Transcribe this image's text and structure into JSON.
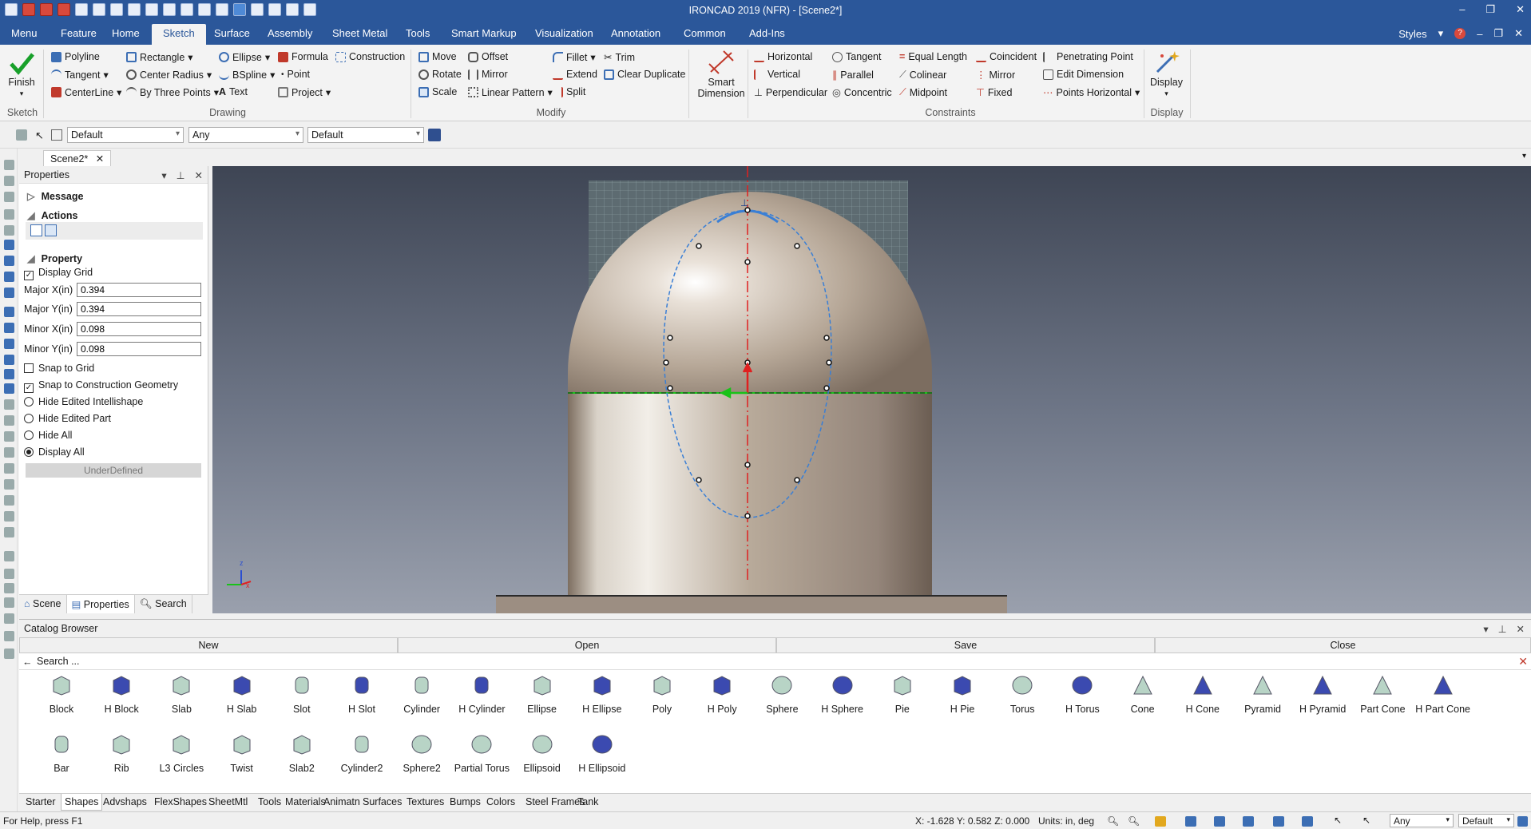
{
  "window": {
    "title": "IRONCAD 2019 (NFR) - [Scene2*]"
  },
  "menu": {
    "tabs": [
      "Menu",
      "Feature",
      "Home",
      "Surface",
      "Assembly",
      "Sheet Metal",
      "Tools",
      "Smart Markup",
      "Visualization",
      "Annotation",
      "Common",
      "Add-Ins"
    ],
    "active": "Sketch",
    "styles_label": "Styles"
  },
  "ribbon": {
    "sketch": {
      "finish": "Finish",
      "group": "Sketch"
    },
    "drawing": {
      "items": [
        "Polyline",
        "Rectangle",
        "Ellipse",
        "Formula",
        "Construction",
        "Tangent",
        "Center Radius",
        "BSpline",
        "Point",
        "CenterLine",
        "By Three Points",
        "Text",
        "Project"
      ],
      "group": "Drawing"
    },
    "modify": {
      "items": [
        "Move",
        "Offset",
        "Fillet",
        "Trim",
        "Rotate",
        "Mirror",
        "Extend",
        "Clear Duplicate",
        "Scale",
        "Linear Pattern",
        "Split"
      ],
      "group": "Modify"
    },
    "smart_dimension": "Smart Dimension",
    "constraints": {
      "items": [
        "Horizontal",
        "Tangent",
        "Equal Length",
        "Coincident",
        "Penetrating Point",
        "Vertical",
        "Parallel",
        "Colinear",
        "Mirror",
        "Edit Dimension",
        "Perpendicular",
        "Concentric",
        "Midpoint",
        "Fixed",
        "Points Horizontal"
      ],
      "group": "Constraints"
    },
    "display": {
      "label": "Display",
      "group": "Display"
    }
  },
  "toolbar": {
    "combo1": "Default",
    "combo2": "Any",
    "combo3": "Default"
  },
  "doc_tab": "Scene2*",
  "properties": {
    "title": "Properties",
    "message": "Message",
    "actions": "Actions",
    "property": "Property",
    "display_grid": "Display Grid",
    "fields": [
      {
        "label": "Major X(in)",
        "value": "0.394"
      },
      {
        "label": "Major Y(in)",
        "value": "0.394"
      },
      {
        "label": "Minor X(in)",
        "value": "0.098"
      },
      {
        "label": "Minor Y(in)",
        "value": "0.098"
      }
    ],
    "snap_grid": "Snap to Grid",
    "snap_construction": "Snap to Construction Geometry",
    "radios": [
      "Hide Edited Intellishape",
      "Hide Edited Part",
      "Hide All",
      "Display All"
    ],
    "status": "UnderDefined",
    "tabs": [
      "Scene",
      "Properties",
      "Search"
    ]
  },
  "catalog": {
    "title": "Catalog Browser",
    "buttons": [
      "New",
      "Open",
      "Save",
      "Close"
    ],
    "search_placeholder": "Search ...",
    "row1": [
      "Block",
      "H Block",
      "Slab",
      "H Slab",
      "Slot",
      "H Slot",
      "Cylinder",
      "H Cylinder",
      "Ellipse",
      "H Ellipse",
      "Poly",
      "H Poly",
      "Sphere",
      "H Sphere",
      "Pie",
      "H Pie",
      "Torus",
      "H Torus",
      "Cone",
      "H Cone",
      "Pyramid",
      "H Pyramid",
      "Part Cone",
      "H Part Cone"
    ],
    "row2": [
      "Bar",
      "Rib",
      "L3 Circles",
      "Twist",
      "Slab2",
      "Cylinder2",
      "Sphere2",
      "Partial Torus",
      "Ellipsoid",
      "H Ellipsoid"
    ],
    "tabs": [
      "Starter",
      "Shapes",
      "Advshaps",
      "FlexShapes",
      "SheetMtl",
      "Tools",
      "Materials",
      "Animatn",
      "Surfaces",
      "Textures",
      "Bumps",
      "Colors",
      "Steel Frames",
      "Tank"
    ],
    "active_tab": "Shapes"
  },
  "status": {
    "help": "For Help, press F1",
    "coords": "X: -1.628 Y: 0.582 Z: 0.000",
    "units": "Units: in, deg",
    "combo_any": "Any",
    "combo_default": "Default"
  },
  "colors": {
    "accent": "#2b579a",
    "sketch_curve": "#3a7fd5",
    "axis_red": "#e02020",
    "axis_green": "#19c219"
  }
}
